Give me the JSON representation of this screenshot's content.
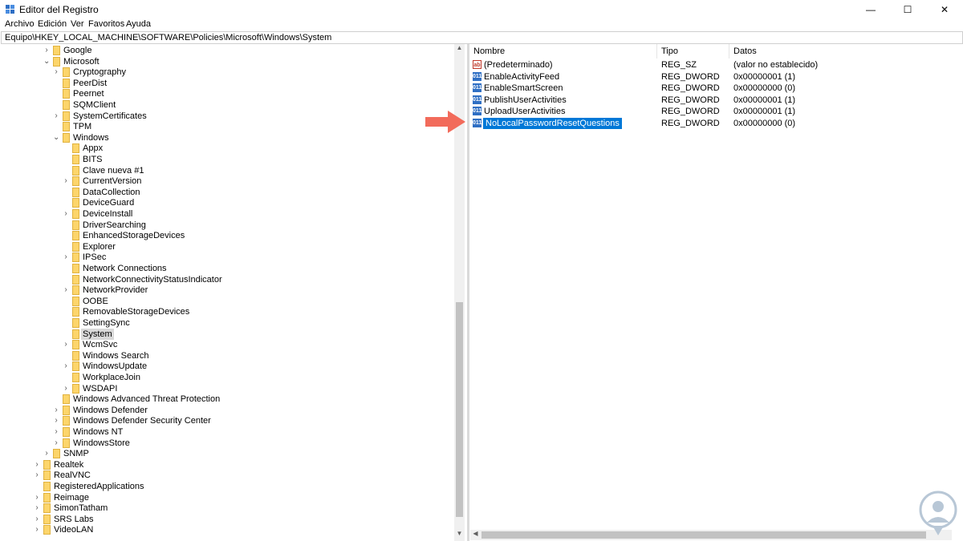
{
  "window": {
    "title": "Editor del Registro",
    "controls": {
      "minimize": "—",
      "maximize": "☐",
      "close": "✕"
    }
  },
  "menu": [
    "Archivo",
    "Edición",
    "Ver",
    "Favoritos",
    "Ayuda"
  ],
  "address": "Equipo\\HKEY_LOCAL_MACHINE\\SOFTWARE\\Policies\\Microsoft\\Windows\\System",
  "tree": [
    {
      "label": "Google",
      "depth": 1,
      "state": "collapsed",
      "selected": false
    },
    {
      "label": "Microsoft",
      "depth": 1,
      "state": "expanded",
      "selected": false
    },
    {
      "label": "Cryptography",
      "depth": 2,
      "state": "collapsed",
      "selected": false
    },
    {
      "label": "PeerDist",
      "depth": 2,
      "state": "none",
      "selected": false
    },
    {
      "label": "Peernet",
      "depth": 2,
      "state": "none",
      "selected": false
    },
    {
      "label": "SQMClient",
      "depth": 2,
      "state": "none",
      "selected": false
    },
    {
      "label": "SystemCertificates",
      "depth": 2,
      "state": "collapsed",
      "selected": false
    },
    {
      "label": "TPM",
      "depth": 2,
      "state": "none",
      "selected": false
    },
    {
      "label": "Windows",
      "depth": 2,
      "state": "expanded",
      "selected": false
    },
    {
      "label": "Appx",
      "depth": 3,
      "state": "none",
      "selected": false
    },
    {
      "label": "BITS",
      "depth": 3,
      "state": "none",
      "selected": false
    },
    {
      "label": "Clave nueva #1",
      "depth": 3,
      "state": "none",
      "selected": false
    },
    {
      "label": "CurrentVersion",
      "depth": 3,
      "state": "collapsed",
      "selected": false
    },
    {
      "label": "DataCollection",
      "depth": 3,
      "state": "none",
      "selected": false
    },
    {
      "label": "DeviceGuard",
      "depth": 3,
      "state": "none",
      "selected": false
    },
    {
      "label": "DeviceInstall",
      "depth": 3,
      "state": "collapsed",
      "selected": false
    },
    {
      "label": "DriverSearching",
      "depth": 3,
      "state": "none",
      "selected": false
    },
    {
      "label": "EnhancedStorageDevices",
      "depth": 3,
      "state": "none",
      "selected": false
    },
    {
      "label": "Explorer",
      "depth": 3,
      "state": "none",
      "selected": false
    },
    {
      "label": "IPSec",
      "depth": 3,
      "state": "collapsed",
      "selected": false
    },
    {
      "label": "Network Connections",
      "depth": 3,
      "state": "none",
      "selected": false
    },
    {
      "label": "NetworkConnectivityStatusIndicator",
      "depth": 3,
      "state": "none",
      "selected": false
    },
    {
      "label": "NetworkProvider",
      "depth": 3,
      "state": "collapsed",
      "selected": false
    },
    {
      "label": "OOBE",
      "depth": 3,
      "state": "none",
      "selected": false
    },
    {
      "label": "RemovableStorageDevices",
      "depth": 3,
      "state": "none",
      "selected": false
    },
    {
      "label": "SettingSync",
      "depth": 3,
      "state": "none",
      "selected": false
    },
    {
      "label": "System",
      "depth": 3,
      "state": "none",
      "selected": true
    },
    {
      "label": "WcmSvc",
      "depth": 3,
      "state": "collapsed",
      "selected": false
    },
    {
      "label": "Windows Search",
      "depth": 3,
      "state": "none",
      "selected": false
    },
    {
      "label": "WindowsUpdate",
      "depth": 3,
      "state": "collapsed",
      "selected": false
    },
    {
      "label": "WorkplaceJoin",
      "depth": 3,
      "state": "none",
      "selected": false
    },
    {
      "label": "WSDAPI",
      "depth": 3,
      "state": "collapsed",
      "selected": false
    },
    {
      "label": "Windows Advanced Threat Protection",
      "depth": 2,
      "state": "none",
      "selected": false
    },
    {
      "label": "Windows Defender",
      "depth": 2,
      "state": "collapsed",
      "selected": false
    },
    {
      "label": "Windows Defender Security Center",
      "depth": 2,
      "state": "collapsed",
      "selected": false
    },
    {
      "label": "Windows NT",
      "depth": 2,
      "state": "collapsed",
      "selected": false
    },
    {
      "label": "WindowsStore",
      "depth": 2,
      "state": "collapsed",
      "selected": false
    },
    {
      "label": "SNMP",
      "depth": 1,
      "state": "collapsed",
      "selected": false
    },
    {
      "label": "Realtek",
      "depth": 0,
      "state": "collapsed",
      "selected": false
    },
    {
      "label": "RealVNC",
      "depth": 0,
      "state": "collapsed",
      "selected": false
    },
    {
      "label": "RegisteredApplications",
      "depth": 0,
      "state": "none",
      "selected": false
    },
    {
      "label": "Reimage",
      "depth": 0,
      "state": "collapsed",
      "selected": false
    },
    {
      "label": "SimonTatham",
      "depth": 0,
      "state": "collapsed",
      "selected": false
    },
    {
      "label": "SRS Labs",
      "depth": 0,
      "state": "collapsed",
      "selected": false
    },
    {
      "label": "VideoLAN",
      "depth": 0,
      "state": "collapsed",
      "selected": false
    }
  ],
  "list": {
    "columns": {
      "name": "Nombre",
      "type": "Tipo",
      "data": "Datos"
    },
    "rows": [
      {
        "icon": "string-value-icon",
        "name": "(Predeterminado)",
        "type": "REG_SZ",
        "data": "(valor no establecido)",
        "selected": false
      },
      {
        "icon": "dword-value-icon",
        "name": "EnableActivityFeed",
        "type": "REG_DWORD",
        "data": "0x00000001 (1)",
        "selected": false
      },
      {
        "icon": "dword-value-icon",
        "name": "EnableSmartScreen",
        "type": "REG_DWORD",
        "data": "0x00000000 (0)",
        "selected": false
      },
      {
        "icon": "dword-value-icon",
        "name": "PublishUserActivities",
        "type": "REG_DWORD",
        "data": "0x00000001 (1)",
        "selected": false
      },
      {
        "icon": "dword-value-icon",
        "name": "UploadUserActivities",
        "type": "REG_DWORD",
        "data": "0x00000001 (1)",
        "selected": false
      },
      {
        "icon": "dword-value-icon",
        "name": "NoLocalPasswordResetQuestions",
        "type": "REG_DWORD",
        "data": "0x00000000 (0)",
        "selected": true
      }
    ]
  },
  "colors": {
    "selection": "#0078d7",
    "tree_selection": "#d9d9d9",
    "annotation_arrow": "#f26b5b",
    "folder": "#fcd56b"
  }
}
